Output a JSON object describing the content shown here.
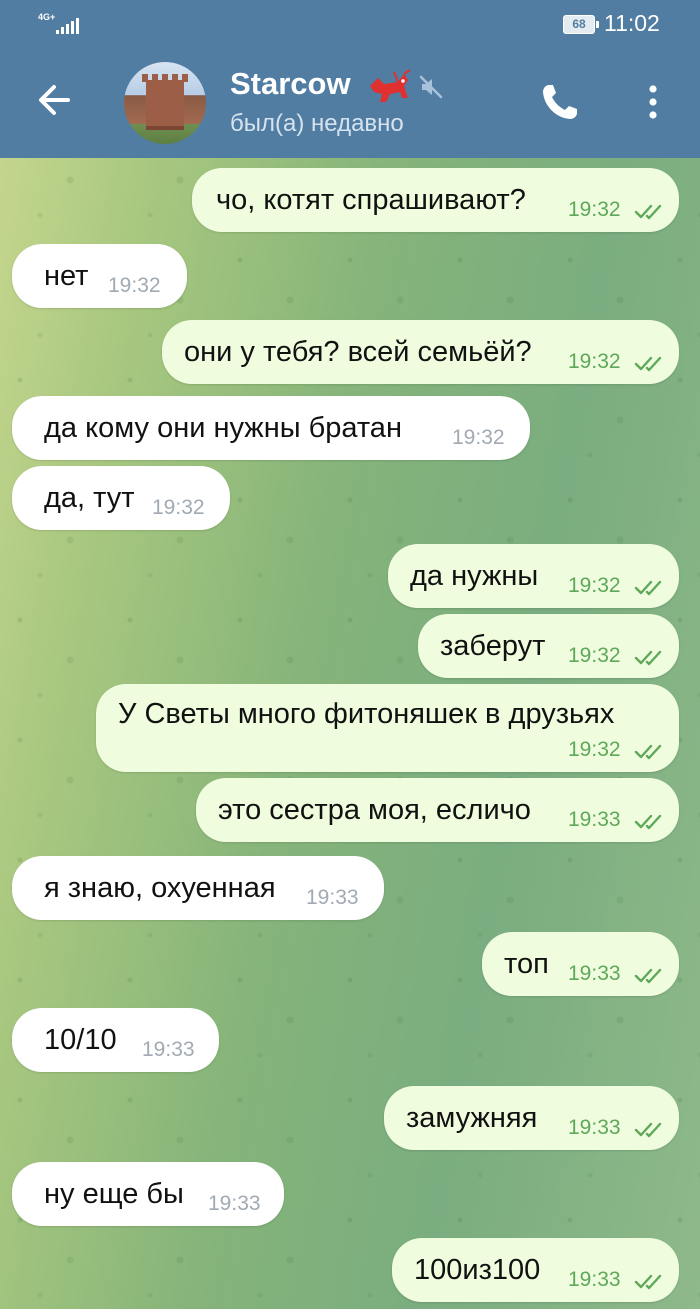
{
  "status_bar": {
    "network": "4G+",
    "battery": "68",
    "time": "11:02"
  },
  "header": {
    "contact_name": "Starcow",
    "contact_status": "был(а) недавно"
  },
  "messages": [
    {
      "direction": "out",
      "text": "чо, котят спрашивают?",
      "time": "19:32",
      "read": true
    },
    {
      "direction": "in",
      "text": "нет",
      "time": "19:32"
    },
    {
      "direction": "out",
      "text": "они у тебя? всей семьёй?",
      "time": "19:32",
      "read": true
    },
    {
      "direction": "in",
      "text": "да кому они нужны братан",
      "time": "19:32"
    },
    {
      "direction": "in",
      "text": "да, тут",
      "time": "19:32"
    },
    {
      "direction": "out",
      "text": "да нужны",
      "time": "19:32",
      "read": true
    },
    {
      "direction": "out",
      "text": "заберут",
      "time": "19:32",
      "read": true
    },
    {
      "direction": "out",
      "text": "У Светы много фитоняшек в друзьях",
      "time": "19:32",
      "read": true
    },
    {
      "direction": "out",
      "text": "это сестра моя, есличо",
      "time": "19:33",
      "read": true
    },
    {
      "direction": "in",
      "text": "я знаю, охуенная",
      "time": "19:33"
    },
    {
      "direction": "out",
      "text": "топ",
      "time": "19:33",
      "read": true
    },
    {
      "direction": "in",
      "text": "10/10",
      "time": "19:33"
    },
    {
      "direction": "out",
      "text": "замужняя",
      "time": "19:33",
      "read": true
    },
    {
      "direction": "in",
      "text": "ну еще бы",
      "time": "19:33"
    },
    {
      "direction": "out",
      "text": "100из100",
      "time": "19:33",
      "read": true
    }
  ],
  "colors": {
    "header": "#517da2",
    "outgoing_bubble": "#effdde",
    "incoming_bubble": "#ffffff",
    "outgoing_time": "#5fa85a",
    "incoming_time": "#a1aab3"
  },
  "icons": {
    "back": "arrow-left-icon",
    "mute": "muted-speaker-icon",
    "call": "phone-icon",
    "menu": "more-vertical-icon",
    "read": "double-check-icon"
  }
}
